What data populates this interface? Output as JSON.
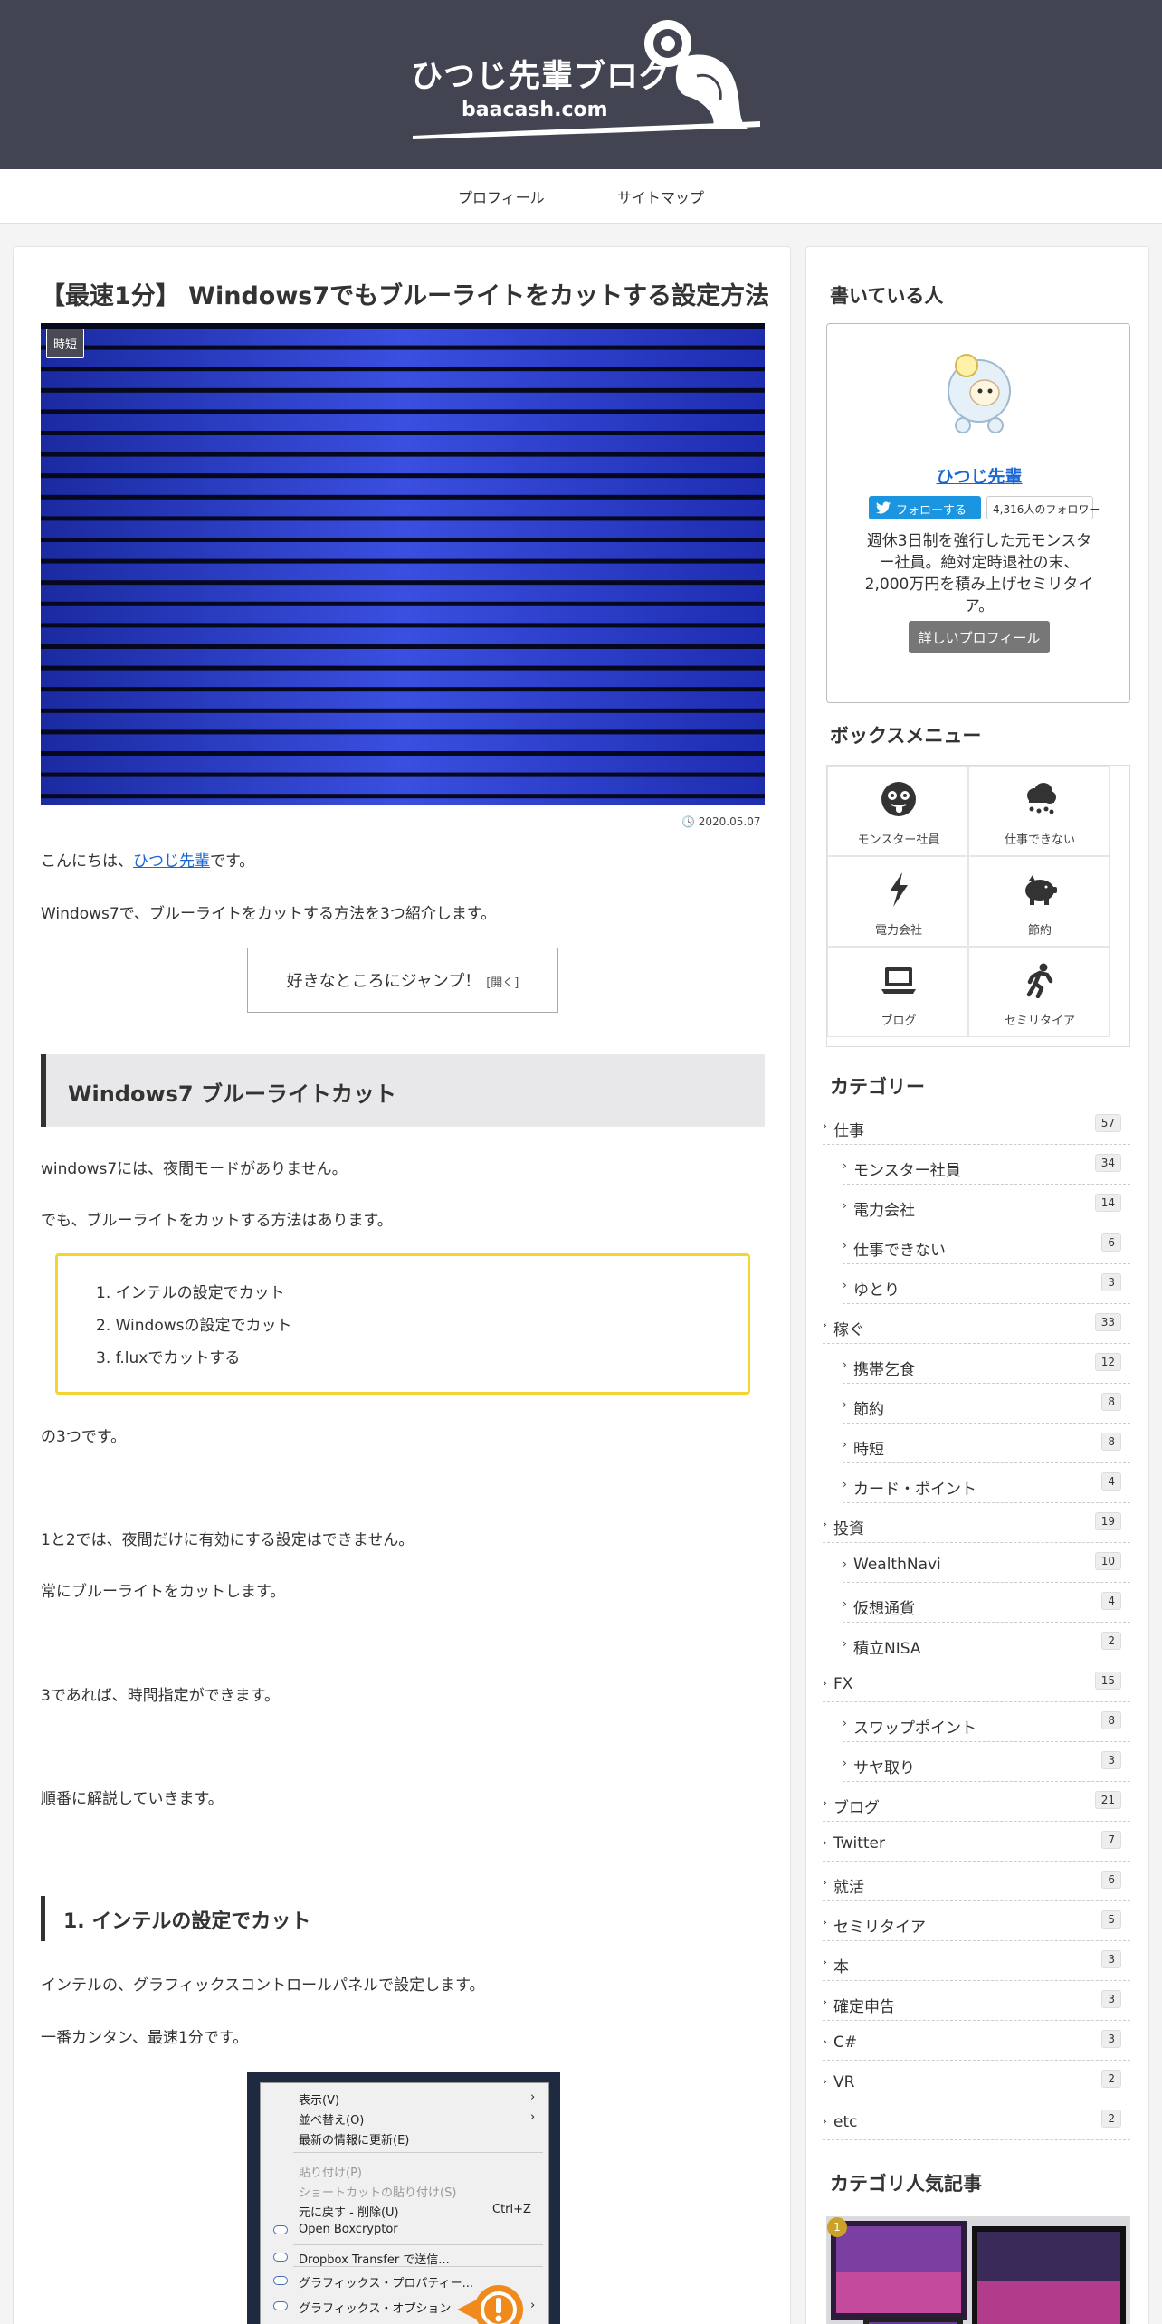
{
  "site": {
    "title": "ひつじ先輩ブログ",
    "url": "baacash.com"
  },
  "nav": {
    "items": [
      "プロフィール",
      "サイトマップ"
    ]
  },
  "article": {
    "title": "【最速1分】 Windows7でもブルーライトをカットする設定方法",
    "category": "時短",
    "date": "2020.05.07",
    "greeting_pre": "こんにちは、",
    "greeting_link": "ひつじ先輩",
    "greeting_post": "です。",
    "intro": "Windows7で、ブルーライトをカットする方法を3つ紹介します。",
    "toc_label": "好きなところにジャンプ！",
    "toc_toggle": "[開く]",
    "h2": "Windows7 ブルーライトカット",
    "p1": "windows7には、夜間モードがありません。",
    "p2": "でも、ブルーライトをカットする方法はあります。",
    "list": [
      "1. インテルの設定でカット",
      "2. Windowsの設定でカット",
      "3. f.luxでカットする"
    ],
    "p3": "の3つです。",
    "p4": "1と2では、夜間だけに有効にする設定はできません。",
    "p5": "常にブルーライトをカットします。",
    "p6": "3であれば、時間指定ができます。",
    "p7": "順番に解説していきます。",
    "h3": "1. インテルの設定でカット",
    "p8": "インテルの、グラフィックスコントロールパネルで設定します。",
    "p9": "一番カンタン、最速1分です。",
    "context_menu": {
      "items": [
        {
          "label": "表示(V)",
          "sub": true
        },
        {
          "label": "並べ替え(O)",
          "sub": true
        },
        {
          "label": "最新の情報に更新(E)"
        },
        {
          "label": "貼り付け(P)",
          "disabled": true
        },
        {
          "label": "ショートカットの貼り付け(S)",
          "disabled": true
        },
        {
          "label": "元に戻す - 削除(U)",
          "shortcut": "Ctrl+Z"
        },
        {
          "label": "Open Boxcryptor"
        },
        {
          "label": "Dropbox Transfer で送信..."
        },
        {
          "label": "グラフィックス・プロパティー..."
        },
        {
          "label": "グラフィックス・オプション",
          "sub": true
        }
      ]
    }
  },
  "sidebar": {
    "author_heading": "書いている人",
    "author": {
      "name": "ひつじ先輩",
      "follow_label": "フォローする",
      "followers": "4,316人のフォロワー",
      "description": "週休3日制を強行した元モンスター社員。絶対定時退社の末、2,000万円を積み上げセミリタイア。",
      "profile_button": "詳しいプロフィール"
    },
    "boxmenu_heading": "ボックスメニュー",
    "boxmenu": [
      {
        "label": "モンスター社員",
        "icon": "tongue-face-icon"
      },
      {
        "label": "仕事できない",
        "icon": "rain-cloud-icon"
      },
      {
        "label": "電力会社",
        "icon": "lightning-icon"
      },
      {
        "label": "節約",
        "icon": "piggy-bank-icon"
      },
      {
        "label": "ブログ",
        "icon": "laptop-icon"
      },
      {
        "label": "セミリタイア",
        "icon": "running-person-icon"
      }
    ],
    "categories_heading": "カテゴリー",
    "categories": [
      {
        "name": "仕事",
        "count": "57",
        "level": 0
      },
      {
        "name": "モンスター社員",
        "count": "34",
        "level": 1
      },
      {
        "name": "電力会社",
        "count": "14",
        "level": 1
      },
      {
        "name": "仕事できない",
        "count": "6",
        "level": 1
      },
      {
        "name": "ゆとり",
        "count": "3",
        "level": 1
      },
      {
        "name": "稼ぐ",
        "count": "33",
        "level": 0
      },
      {
        "name": "携帯乞食",
        "count": "12",
        "level": 1
      },
      {
        "name": "節約",
        "count": "8",
        "level": 1
      },
      {
        "name": "時短",
        "count": "8",
        "level": 1
      },
      {
        "name": "カード・ポイント",
        "count": "4",
        "level": 1
      },
      {
        "name": "投資",
        "count": "19",
        "level": 0
      },
      {
        "name": "WealthNavi",
        "count": "10",
        "level": 1
      },
      {
        "name": "仮想通貨",
        "count": "4",
        "level": 1
      },
      {
        "name": "積立NISA",
        "count": "2",
        "level": 1
      },
      {
        "name": "FX",
        "count": "15",
        "level": 0
      },
      {
        "name": "スワップポイント",
        "count": "8",
        "level": 1
      },
      {
        "name": "サヤ取り",
        "count": "3",
        "level": 1
      },
      {
        "name": "ブログ",
        "count": "21",
        "level": 0
      },
      {
        "name": "Twitter",
        "count": "7",
        "level": 0
      },
      {
        "name": "就活",
        "count": "6",
        "level": 0
      },
      {
        "name": "セミリタイア",
        "count": "5",
        "level": 0
      },
      {
        "name": "本",
        "count": "3",
        "level": 0
      },
      {
        "name": "確定申告",
        "count": "3",
        "level": 0
      },
      {
        "name": "C#",
        "count": "3",
        "level": 0
      },
      {
        "name": "VR",
        "count": "2",
        "level": 0
      },
      {
        "name": "etc",
        "count": "2",
        "level": 0
      }
    ],
    "popular_heading": "カテゴリ人気記事",
    "popular_rank": "1"
  },
  "colors": {
    "header_bg": "#424451",
    "accent_yellow": "#f2d530",
    "link": "#1967d2",
    "twitter": "#1b95e0"
  }
}
